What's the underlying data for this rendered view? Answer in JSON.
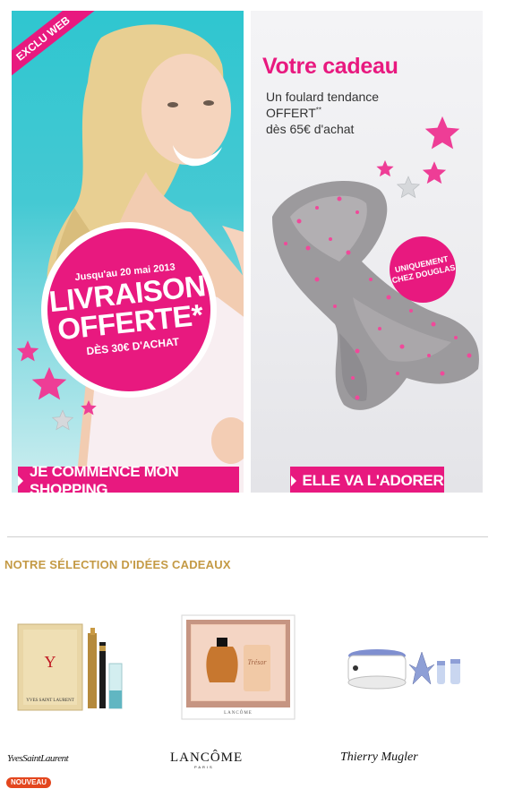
{
  "banner_left": {
    "exclu": "EXCLU WEB",
    "promo_date": "Jusqu'au 20 mai 2013",
    "promo_line1": "LIVRAISON",
    "promo_line2": "OFFERTE*",
    "promo_line3": "DÈS 30€ D'ACHAT",
    "cta": "JE COMMENCE MON SHOPPING"
  },
  "banner_right": {
    "title": "Votre cadeau",
    "line1": "Un foulard tendance",
    "line2": "OFFERT",
    "line2_sup": "**",
    "line3": "dès 65€ d'achat",
    "badge_line1": "UNIQUEMENT",
    "badge_line2": "CHEZ DOUGLAS",
    "cta": "ELLE VA L'ADORER"
  },
  "selection": {
    "title": "NOTRE SÉLECTION D'IDÉES CADEAUX",
    "products": [
      {
        "brand": "YvesSaintLaurent",
        "badge": "NOUVEAU"
      },
      {
        "brand": "LANCÔME",
        "brand_sub": "PARIS"
      },
      {
        "brand": "Thierry Mugler"
      }
    ]
  },
  "colors": {
    "accent_pink": "#e8197f",
    "gold": "#c49a45",
    "badge_orange": "#e3461e",
    "teal": "#2fc6d0"
  }
}
